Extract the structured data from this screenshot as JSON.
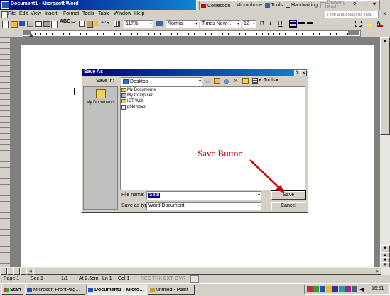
{
  "window": {
    "title": "Document1 - Microsoft Word",
    "lang_buttons": [
      "Correction",
      "Microphone",
      "Tools",
      "Handwriting",
      "Drawing Pad"
    ],
    "help_placeholder": "Type a question for help"
  },
  "menu": [
    "File",
    "Edit",
    "View",
    "Insert",
    "Format",
    "Tools",
    "Table",
    "Window",
    "Help"
  ],
  "toolbar": {
    "zoom": "117%",
    "style": "Normal",
    "font": "Times New Roman",
    "size": "12"
  },
  "dialog": {
    "title": "Save As",
    "save_in_label": "Save in:",
    "save_in_value": "Desktop",
    "tools_label": "Tools",
    "places": [
      "My Documents"
    ],
    "files": [
      "My Documents",
      "My Computer",
      "ICT Web",
      "phkrmsvs"
    ],
    "file_name_label": "File name:",
    "file_name_value": "Sadi",
    "save_as_type_label": "Save as type:",
    "save_as_type_value": "Word Document",
    "save_button": "Save",
    "cancel_button": "Cancel"
  },
  "annotation": {
    "text": "Save Button",
    "color": "#cc0000"
  },
  "statusbar": [
    "Page 1",
    "Sec 1",
    "1/1",
    "At 2.5cm",
    "Ln 1",
    "Col 1",
    "REC",
    "TRK",
    "EXT",
    "OVR"
  ],
  "taskbar": {
    "start": "Start",
    "tasks": [
      "Microsoft FrontPage - E:\\...",
      "Document1 - Microsof...",
      "untitled - Paint"
    ],
    "clock": "16:51"
  },
  "colors": {
    "titlebar": "#000080",
    "chrome": "#d4d0c8",
    "desktop": "#808080"
  }
}
